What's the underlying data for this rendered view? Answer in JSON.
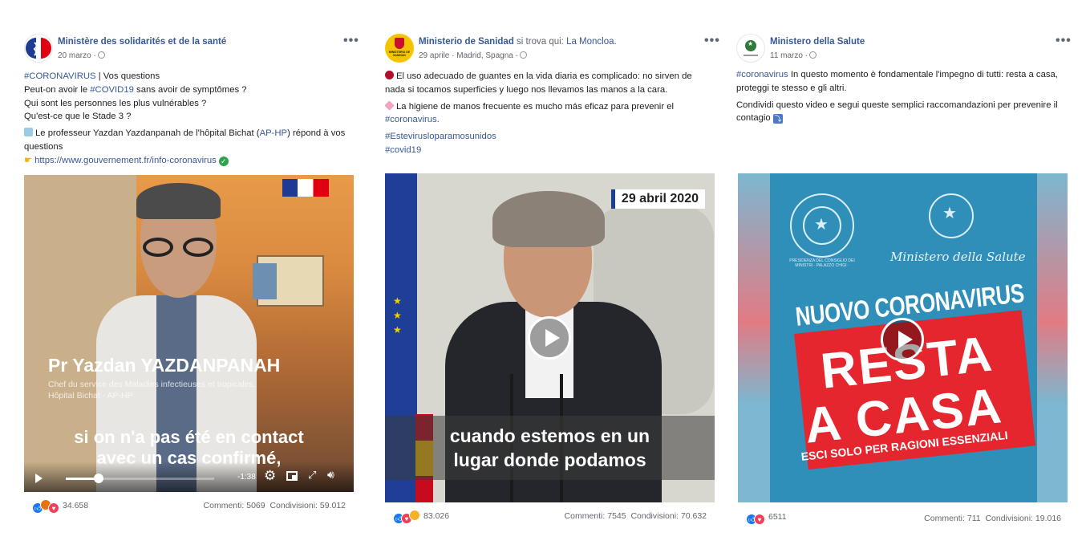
{
  "posts": [
    {
      "page": "Ministère des solidarités et de la santé",
      "date": "20 marzo ·",
      "more": "•••",
      "lines": [
        {
          "tag": "#CORONAVIRUS",
          "text": " | Vos questions"
        },
        {
          "pre": "Peut-on avoir le ",
          "tag": "#COVID19",
          "text": " sans avoir de symptômes ?"
        },
        {
          "text": "Qui sont les personnes les plus vulnérables ?"
        },
        {
          "text": "Qu'est-ce que le Stade 3 ?"
        }
      ],
      "p2": {
        "pre": "Le professeur Yazdan Yazdanpanah de l'hôpital Bichat (",
        "link": "AP-HP",
        "post": ") répond à vos questions"
      },
      "p3": {
        "link": "https://www.gouvernement.fr/info-coronavirus"
      },
      "video": {
        "name": "Pr Yazdan YAZDANPANAH",
        "role1": "Chef du service des Maladies infectieuses et tropicales,",
        "role2": "Hôpital Bichat - AP-HP",
        "sub1": "si on n'a pas été en contact",
        "sub2": "avec un cas confirmé,",
        "time": "-1:38",
        "progress": 0.22
      },
      "reactions": "34.658",
      "comments": "Commenti: 5069",
      "shares": "Condivisioni: 59.012"
    },
    {
      "page": "Ministerio de Sanidad",
      "extra": " si trova qui: ",
      "location": "La Moncloa.",
      "date": "29 aprile · Madrid, Spagna ·",
      "more": "•••",
      "avatar_label": "MINISTERIO DE SANIDAD",
      "p1": "El uso adecuado de guantes en la vida diaria es complicado: no sirven de nada si tocamos superficies y luego nos llevamos las manos a la cara.",
      "p2": "La higiene de manos frecuente es mucho más eficaz para prevenir el ",
      "p2tag": "#coronavirus.",
      "tags": [
        "#Estevirusloparamosunidos",
        "#covid19"
      ],
      "video": {
        "date_badge": "29 abril 2020",
        "sub1": "cuando estemos en un",
        "sub2": "lugar donde podamos"
      },
      "reactions": "83.026",
      "comments": "Commenti: 7545",
      "shares": "Condivisioni: 70.632"
    },
    {
      "page": "Ministero della Salute",
      "date": "11 marzo ·",
      "more": "•••",
      "p1tag": "#coronavirus",
      "p1": " In questo momento è fondamentale l'impegno di tutti: resta a casa, proteggi te stesso e gli altri.",
      "p2": "Condividi questo video e segui queste semplici raccomandazioni per prevenire il contagio",
      "video": {
        "seal_text": "PRESIDENZA DEL CONSIGLIO DEI MINISTRI · PALAZZO CHIGI ·",
        "ministry": "Ministero della Salute",
        "line1": "NUOVO CORONAVIRUS",
        "line2": "RESTA",
        "line3": "A CASA",
        "line4": "ESCI SOLO PER RAGIONI ESSENZIALI"
      },
      "reactions": "6511",
      "comments": "Commenti: 711",
      "shares": "Condivisioni: 19.016"
    }
  ],
  "colors": {
    "link": "#385898",
    "like": "#1877f2",
    "love": "#f33e58",
    "haha": "#f7b125",
    "angry": "#e9710f"
  }
}
